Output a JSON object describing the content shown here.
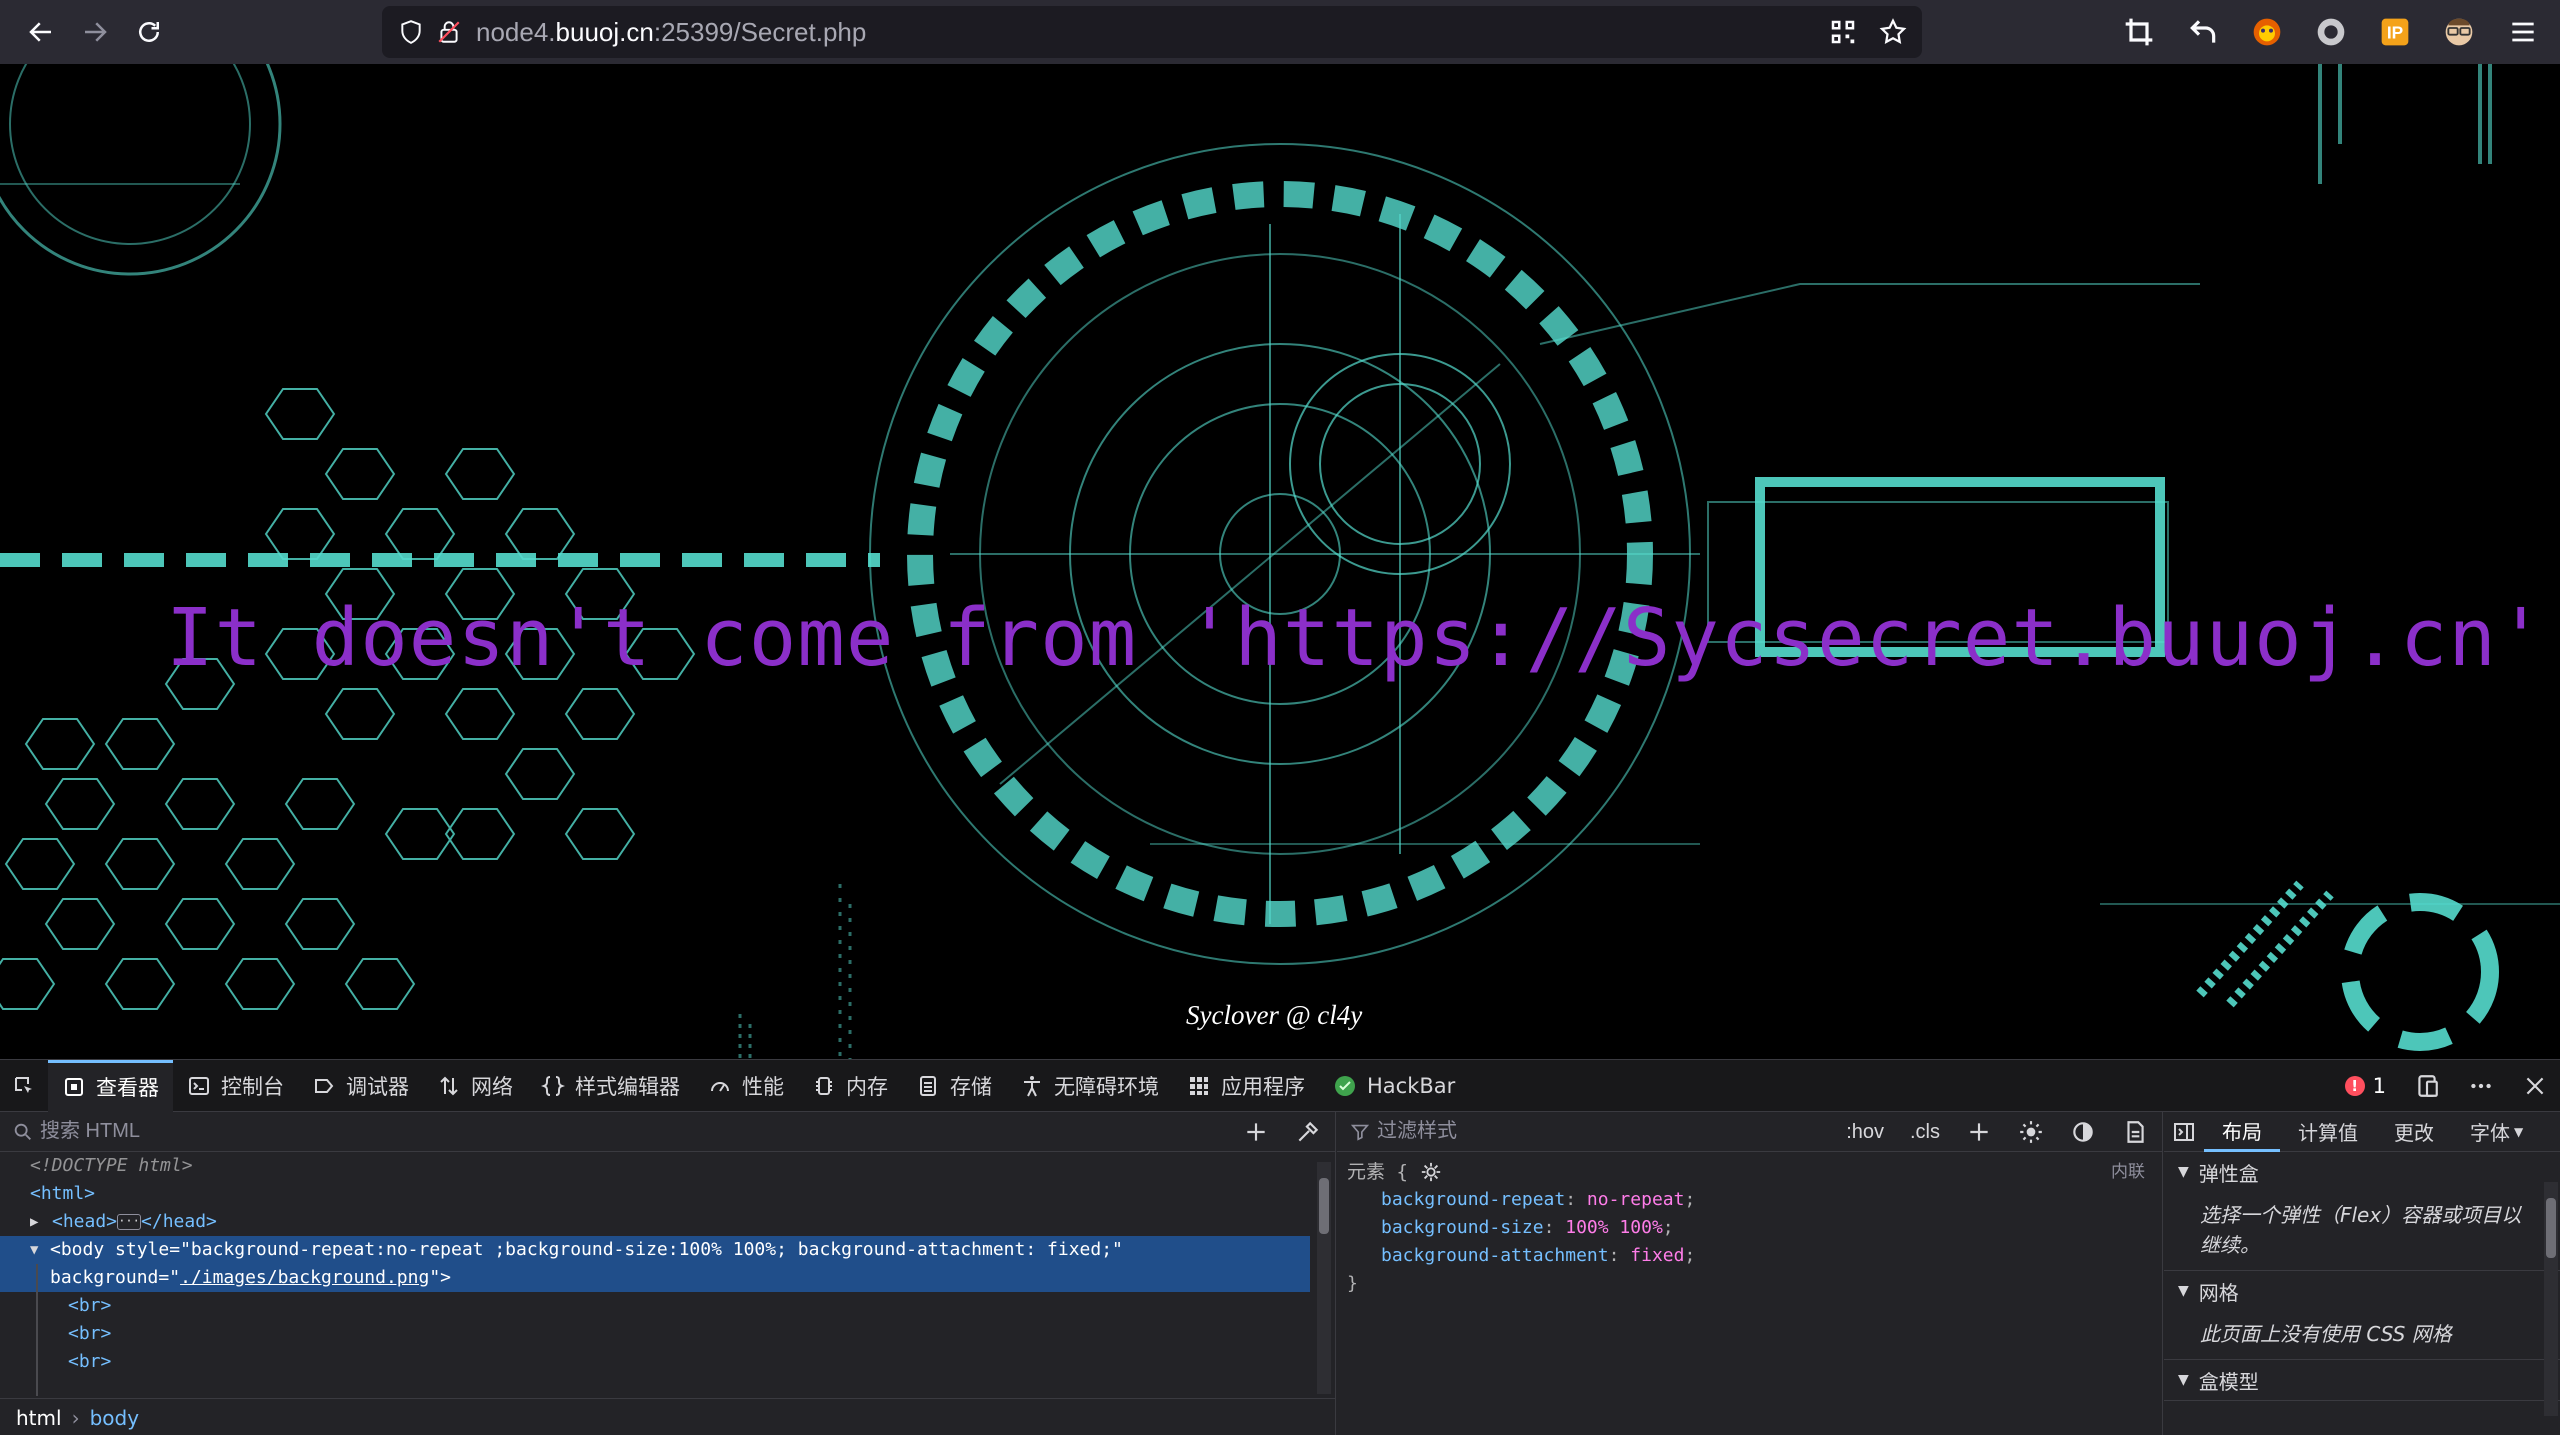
{
  "browser": {
    "url_host_prefix": "node4.",
    "url_host": "buuoj.cn",
    "url_rest": ":25399/Secret.php",
    "icons": [
      "back-icon",
      "forward-icon",
      "reload-icon",
      "shield-icon",
      "insecure-lock-icon",
      "qr-code-icon",
      "bookmark-star-icon",
      "crop-icon",
      "undo-icon",
      "fox-extension-icon",
      "circle-extension-icon",
      "ip-extension-icon",
      "avatar-extension-icon",
      "hamburger-menu-icon"
    ]
  },
  "page": {
    "headline": "It doesn't come from 'https://Sycsecret.buuoj.cn'",
    "credit": "Syclover @ cl4y",
    "headline_color": "#8b2fc9",
    "accent_color": "#5ff5e6"
  },
  "devtools": {
    "tabs": [
      {
        "label": "查看器",
        "icon": "inspector-icon"
      },
      {
        "label": "控制台",
        "icon": "console-icon"
      },
      {
        "label": "调试器",
        "icon": "debugger-icon"
      },
      {
        "label": "网络",
        "icon": "network-icon"
      },
      {
        "label": "样式编辑器",
        "icon": "style-editor-icon"
      },
      {
        "label": "性能",
        "icon": "performance-icon"
      },
      {
        "label": "内存",
        "icon": "memory-icon"
      },
      {
        "label": "存储",
        "icon": "storage-icon"
      },
      {
        "label": "无障碍环境",
        "icon": "accessibility-icon"
      },
      {
        "label": "应用程序",
        "icon": "application-icon"
      },
      {
        "label": "HackBar",
        "icon": "hackbar-icon"
      }
    ],
    "error_count": "1",
    "html_search_placeholder": "搜索 HTML",
    "rules_filter_placeholder": "过滤样式",
    "rules_hov": ":hov",
    "rules_cls": ".cls",
    "tree": {
      "doctype": "<!DOCTYPE html>",
      "html_open": "<html>",
      "head_open": "<head>",
      "head_close": "</head>",
      "body_tag": "body",
      "body_attr_style": "style",
      "body_style_value": "\"background-repeat:no-repeat ;background-size:100% 100%; background-attachment: fixed;\"",
      "body_attr_bg": "background",
      "body_bg_value": "./images/background.png",
      "br": "<br>"
    },
    "breadcrumb": {
      "root": "html",
      "current": "body"
    },
    "rules": {
      "selector": "元素 {",
      "source": "内联",
      "close": "}",
      "declarations": [
        {
          "prop": "background-repeat",
          "value": "no-repeat"
        },
        {
          "prop": "background-size",
          "value": "100% 100%"
        },
        {
          "prop": "background-attachment",
          "value": "fixed"
        }
      ]
    },
    "layout_tabs": [
      "布局",
      "计算值",
      "更改",
      "字体"
    ],
    "sections": [
      {
        "title": "弹性盒",
        "body": "选择一个弹性（Flex）容器或项目以继续。"
      },
      {
        "title": "网格",
        "body": "此页面上没有使用 CSS 网格"
      },
      {
        "title": "盒模型",
        "body": ""
      }
    ]
  }
}
